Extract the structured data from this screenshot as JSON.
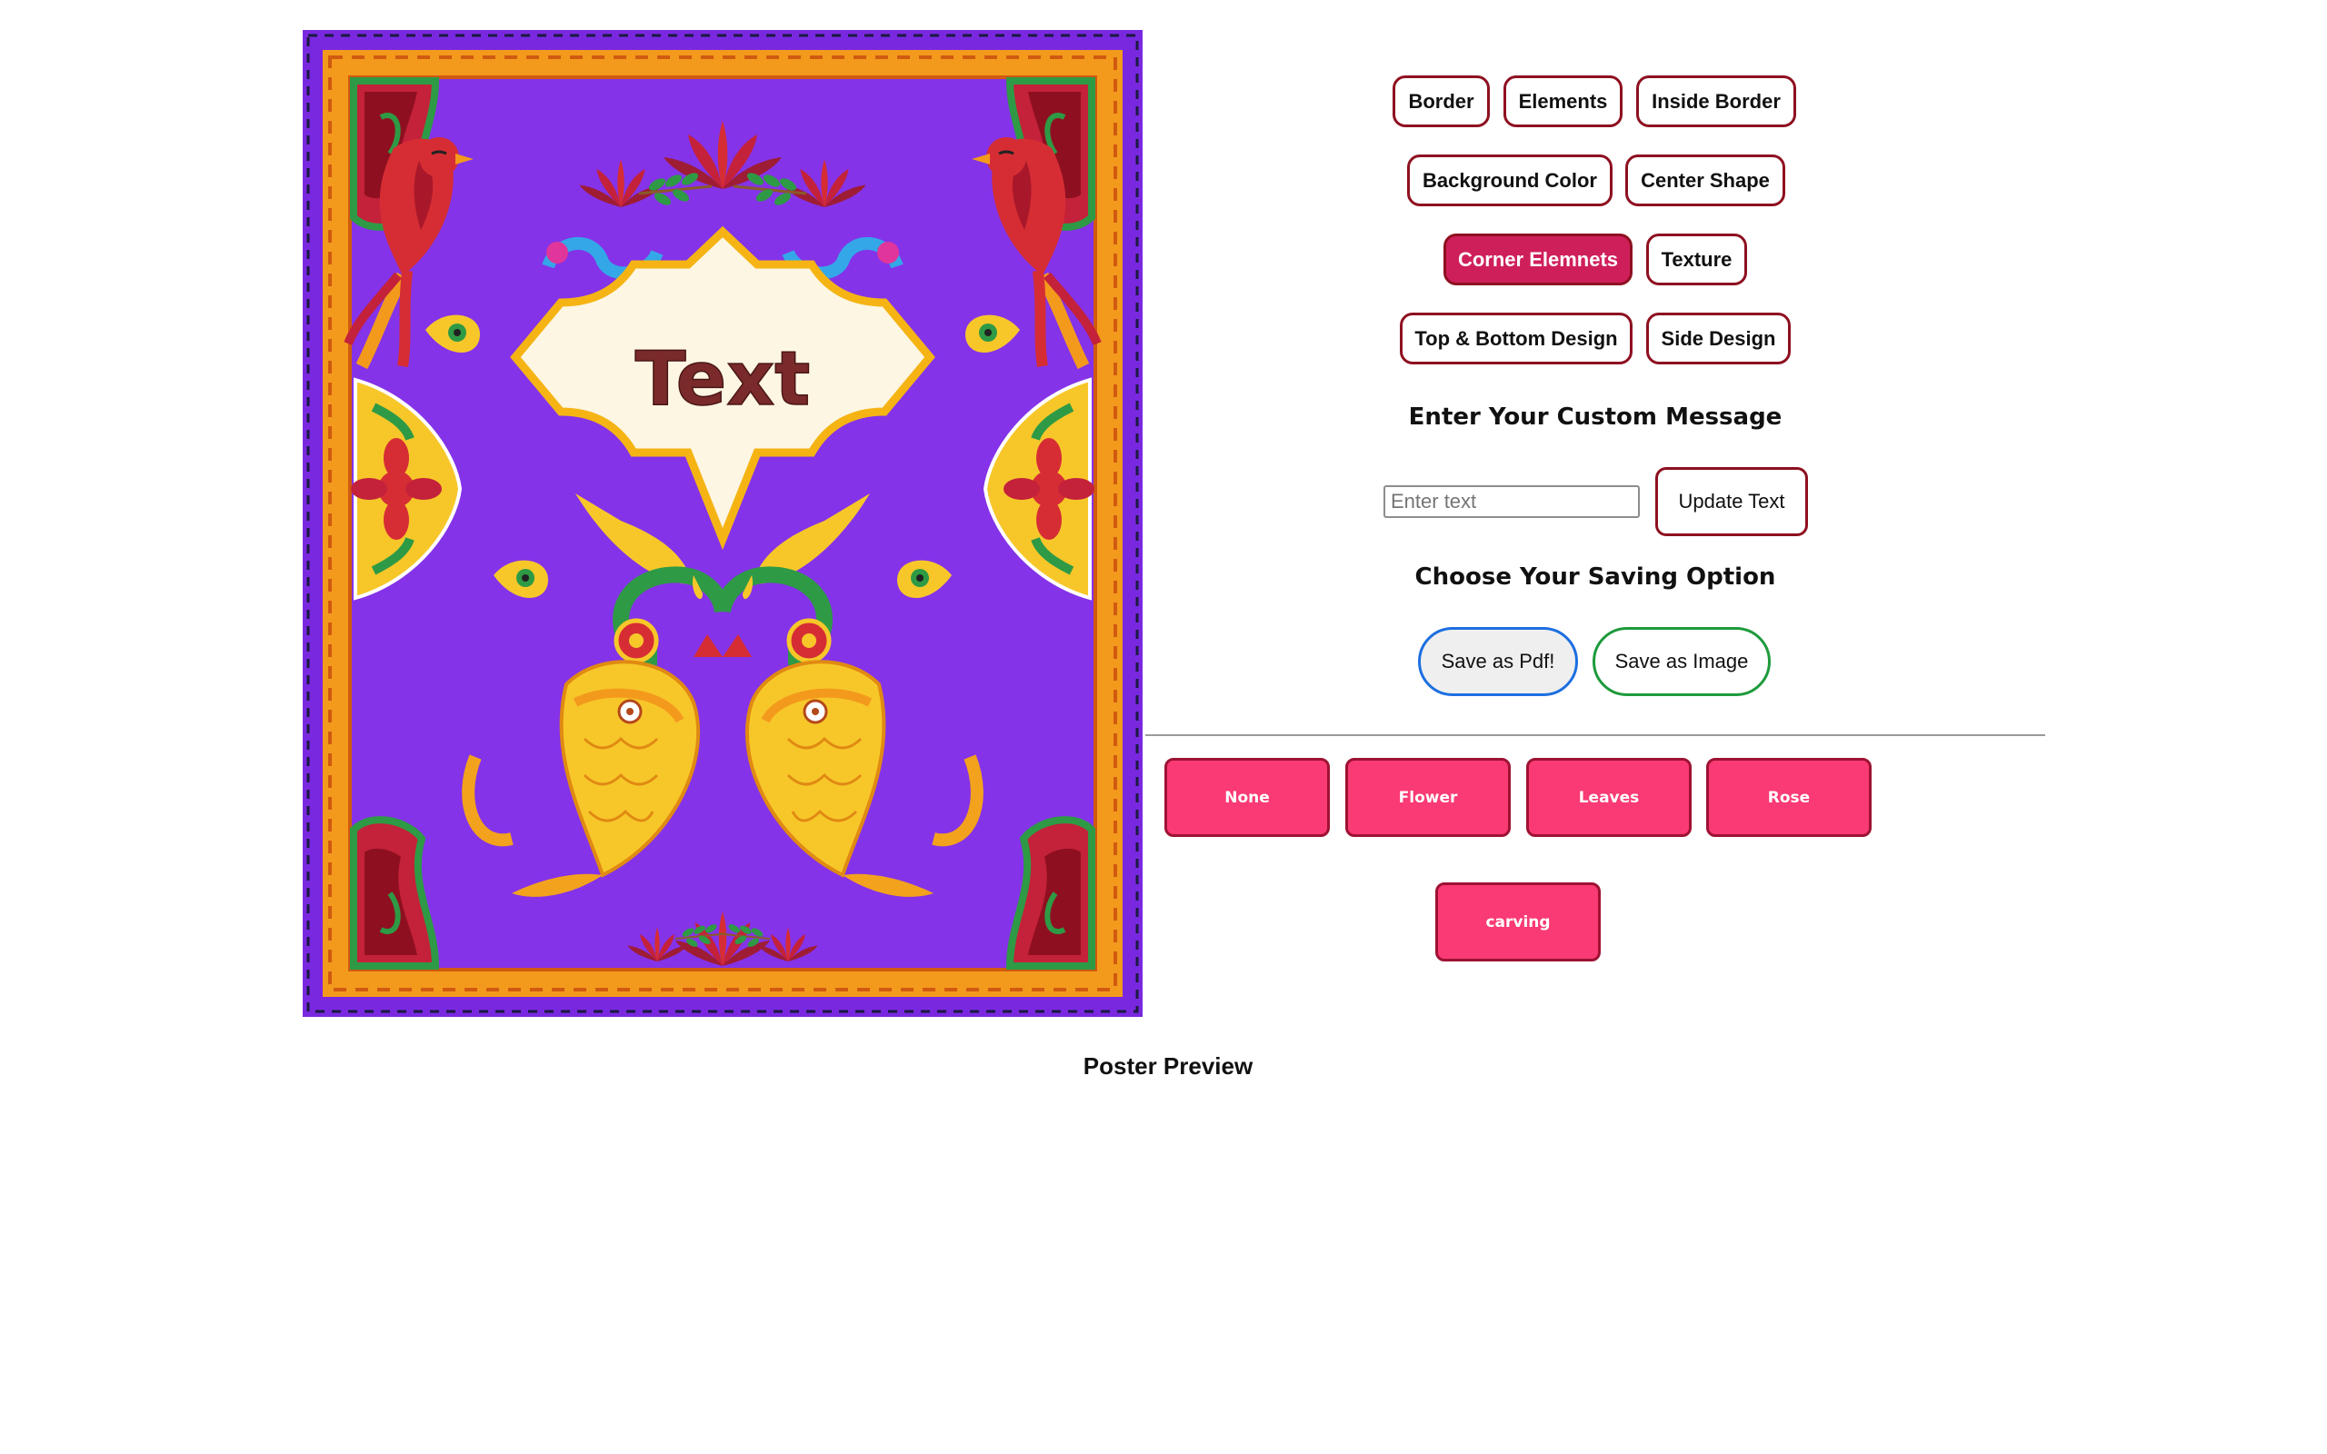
{
  "poster": {
    "text": "Text",
    "colors": {
      "background": "#8433e8",
      "outer_border": "#6b22d0",
      "orange_border": "#f39a1d",
      "frame_fill": "#fdf6e3",
      "frame_stroke": "#f5b414",
      "text_color": "#7a2a2a",
      "red": "#d62d34",
      "yellow": "#f7c72a",
      "green": "#2e9a45",
      "blue": "#34a7e8"
    }
  },
  "options": {
    "buttons": [
      {
        "label": "Border",
        "active": false
      },
      {
        "label": "Elements",
        "active": false
      },
      {
        "label": "Inside Border",
        "active": false
      },
      {
        "label": "Background Color",
        "active": false
      },
      {
        "label": "Center Shape",
        "active": false
      },
      {
        "label": "Corner Elemnets",
        "active": true
      },
      {
        "label": "Texture",
        "active": false
      },
      {
        "label": "Top & Bottom Design",
        "active": false
      },
      {
        "label": "Side Design",
        "active": false
      }
    ]
  },
  "message": {
    "heading": "Enter Your Custom Message",
    "placeholder": "Enter text",
    "value": "",
    "update_label": "Update Text"
  },
  "saving": {
    "heading": "Choose Your Saving Option",
    "pdf_label": "Save as Pdf!",
    "image_label": "Save as Image"
  },
  "corner_choices": [
    {
      "label": "None"
    },
    {
      "label": "Flower"
    },
    {
      "label": "Leaves"
    },
    {
      "label": "Rose"
    },
    {
      "label": "carving"
    }
  ],
  "preview_label": "Poster Preview"
}
